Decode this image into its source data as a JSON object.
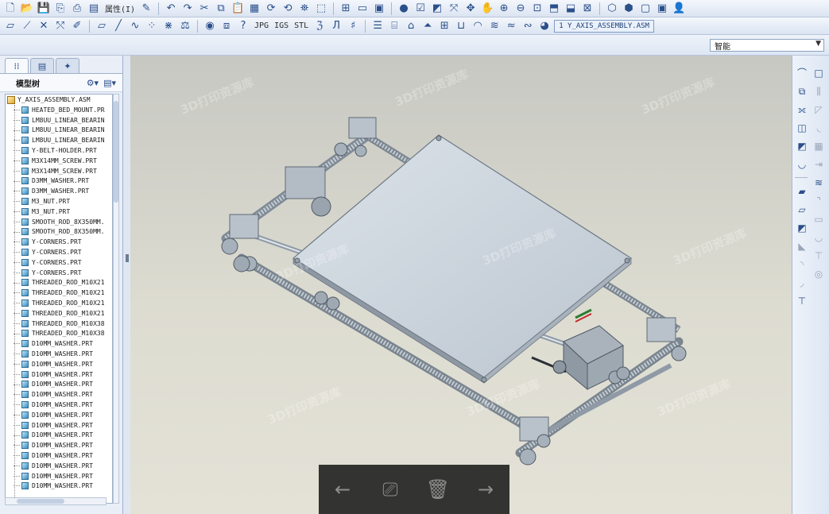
{
  "toolbar_top": {
    "properties_label": "属性(I)",
    "icons": [
      "new-icon",
      "open-icon",
      "save-icon",
      "save-copy-icon",
      "print-icon",
      "properties-icon",
      "undo-icon",
      "redo-icon",
      "cut-icon",
      "copy-icon",
      "paste-icon",
      "paste-special-icon",
      "regenerate-icon",
      "regenerate-manager-icon",
      "find-icon",
      "select-box-icon",
      "model-tree-icon",
      "window-icon",
      "close-window-icon",
      "appearance-icon",
      "layer-icon",
      "render-icon",
      "spin-center-icon",
      "orient-icon",
      "zoom-in-icon",
      "zoom-out-icon",
      "refit-icon",
      "view-manager-icon",
      "saved-views-icon",
      "display-style-icon",
      "wireframe-icon",
      "hidden-line-icon",
      "no-hidden-icon",
      "shading-icon",
      "help-icon"
    ]
  },
  "toolbar_second": {
    "text_buttons": [
      "JPG",
      "IGS",
      "STL"
    ],
    "active_file": "1 Y_AXIS_ASSEMBLY.ASM"
  },
  "toolbar_third": {
    "filter_label": "智能"
  },
  "model_tree": {
    "title": "模型树",
    "root": "Y_AXIS_ASSEMBLY.ASM",
    "items": [
      "HEATED_BED_MOUNT.PR",
      "LM8UU_LINEAR_BEARIN",
      "LM8UU_LINEAR_BEARIN",
      "LM8UU_LINEAR_BEARIN",
      "Y-BELT-HOLDER.PRT",
      "M3X14MM_SCREW.PRT",
      "M3X14MM_SCREW.PRT",
      "D3MM_WASHER.PRT",
      "D3MM_WASHER.PRT",
      "M3_NUT.PRT",
      "M3_NUT.PRT",
      "SMOOTH_ROD_8X350MM.",
      "SMOOTH_ROD_8X350MM.",
      "Y-CORNERS.PRT",
      "Y-CORNERS.PRT",
      "Y-CORNERS.PRT",
      "Y-CORNERS.PRT",
      "THREADED_ROD_M10X21",
      "THREADED_ROD_M10X21",
      "THREADED_ROD_M10X21",
      "THREADED_ROD_M10X21",
      "THREADED_ROD_M10X38",
      "THREADED_ROD_M10X38",
      "D10MM_WASHER.PRT",
      "D10MM_WASHER.PRT",
      "D10MM_WASHER.PRT",
      "D10MM_WASHER.PRT",
      "D10MM_WASHER.PRT",
      "D10MM_WASHER.PRT",
      "D10MM_WASHER.PRT",
      "D10MM_WASHER.PRT",
      "D10MM_WASHER.PRT",
      "D10MM_WASHER.PRT",
      "D10MM_WASHER.PRT",
      "D10MM_WASHER.PRT",
      "D10MM_WASHER.PRT",
      "D10MM_WASHER.PRT",
      "D10MM_WASHER.PRT"
    ]
  },
  "watermark": {
    "text": "3D打印资源库"
  },
  "colors": {
    "canvas_top": "#c7c8c2",
    "canvas_bottom": "#e4e2d7",
    "model_gray": "#c9d2da",
    "accent_blue": "#2a4f8a"
  }
}
